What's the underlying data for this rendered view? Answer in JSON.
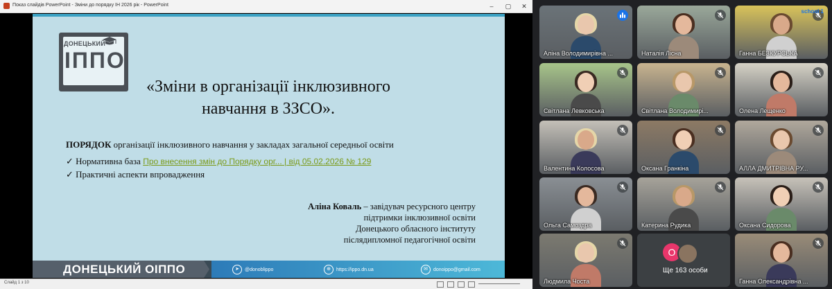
{
  "window": {
    "title": "Показ слайдів PowerPoint - Зміни до порядку ІН 2026 рік - PowerPoint",
    "minimize": "–",
    "maximize": "▢",
    "close": "✕"
  },
  "slide": {
    "logo_small": "ДОНЕЦЬКИЙ",
    "logo_big": "ІППО",
    "title_line1": "«Зміни в організації інклюзивного",
    "title_line2": "навчання в ЗЗСО».",
    "order_bold": "ПОРЯДОК",
    "order_rest": " організації інклюзивного навчання у закладах загальної середньої освіти",
    "bullet1_prefix": "✓ Нормативна база ",
    "bullet1_link": "Про внесення змін до Порядку орг... | від 05.02.2026 № 129",
    "bullet2": "✓ Практичні аспекти впровадження",
    "author_name": "Аліна Коваль",
    "author_line1": " – завідувач ресурсного центру",
    "author_line2": "підтримки інклюзивної освіти",
    "author_line3": "Донецького обласного інституту",
    "author_line4": "післядипломної педагогічної освіти",
    "footer_brand": "ДОНЕЦЬКИЙ ОІППО",
    "contact_telegram": "@donoblippo",
    "contact_site": "https://ippo.dn.ua",
    "contact_email": "donoippo@gmail.com"
  },
  "statusbar": {
    "slide_counter": "Слайд 1 з 10"
  },
  "participants": [
    {
      "name": "Аліна Володимирівна ...",
      "speaking": true
    },
    {
      "name": "Наталія Лісна",
      "speaking": false
    },
    {
      "name": "Ганна БЕЗКУРСЬКА",
      "speaking": false
    },
    {
      "name": "Світлана Левковська",
      "speaking": false
    },
    {
      "name": "Світлана Володимирі...",
      "speaking": false
    },
    {
      "name": "Олена Лещенко",
      "speaking": false
    },
    {
      "name": "Валентина Колосова",
      "speaking": false
    },
    {
      "name": "Оксана Гранкіна",
      "speaking": false
    },
    {
      "name": "АЛЛА ДМИТРІВНА РУ...",
      "speaking": false
    },
    {
      "name": "Ольга Самоздра",
      "speaking": false
    },
    {
      "name": "Катерина Рудика",
      "speaking": false
    },
    {
      "name": "Оксана Сидорова",
      "speaking": false
    },
    {
      "name": "Людмила Чоста",
      "speaking": false
    },
    {
      "name": "Ганна Олександрівна ...",
      "speaking": false
    }
  ],
  "more_tile": {
    "avatar_letter": "О",
    "label": "Ще 163 особи"
  },
  "corner_badge": "school 1"
}
